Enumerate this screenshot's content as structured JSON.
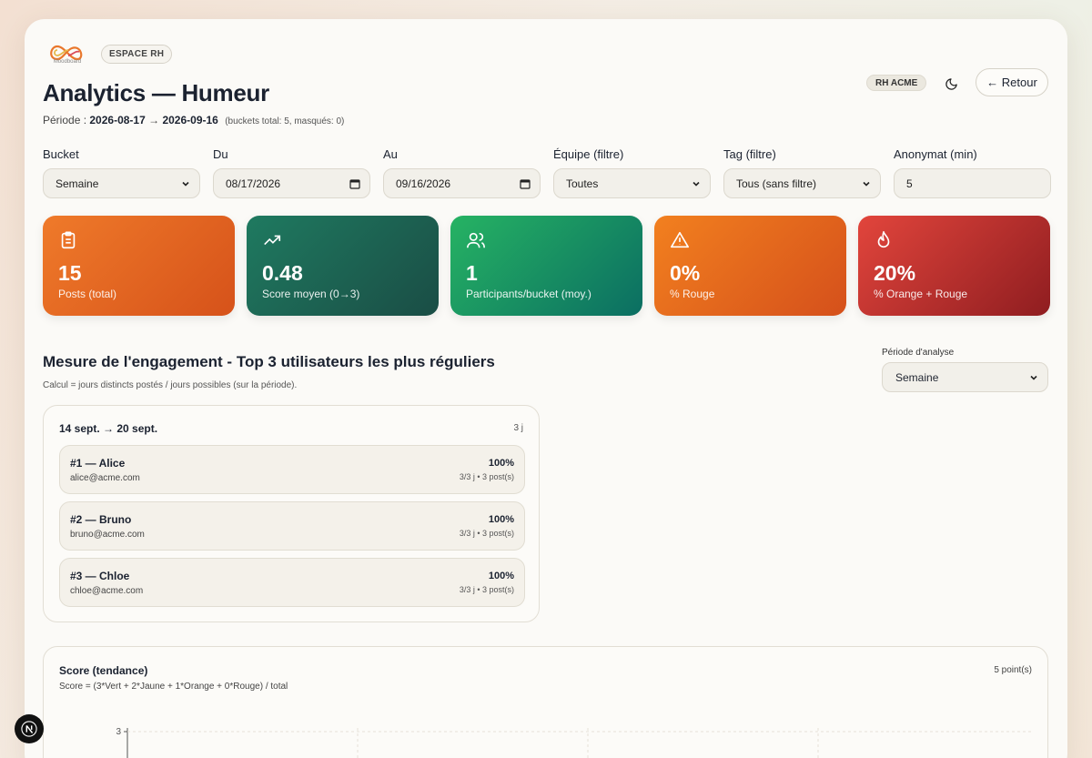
{
  "header": {
    "logo_text": "Moodboard",
    "space_badge": "ESPACE RH",
    "title": "Analytics — Humeur",
    "period_prefix": "Période :",
    "period_start": "2026-08-17",
    "period_arrow": "→",
    "period_end": "2026-09-16",
    "period_meta": "(buckets total: 5, masqués: 0)",
    "org_badge": "RH ACME",
    "back_label": "← Retour"
  },
  "filters": [
    {
      "label": "Bucket",
      "value": "Semaine",
      "kind": "select"
    },
    {
      "label": "Du",
      "value": "08/17/2026",
      "kind": "date"
    },
    {
      "label": "Au",
      "value": "09/16/2026",
      "kind": "date"
    },
    {
      "label": "Équipe (filtre)",
      "value": "Toutes",
      "kind": "select"
    },
    {
      "label": "Tag (filtre)",
      "value": "Tous (sans filtre)",
      "kind": "select"
    },
    {
      "label": "Anonymat (min)",
      "value": "5",
      "kind": "number"
    }
  ],
  "kpis": [
    {
      "value": "15",
      "label": "Posts (total)",
      "icon": "clipboard-icon"
    },
    {
      "value": "0.48",
      "label": "Score moyen (0→3)",
      "icon": "trending-up-icon"
    },
    {
      "value": "1",
      "label": "Participants/bucket (moy.)",
      "icon": "users-icon"
    },
    {
      "value": "0%",
      "label": "% Rouge",
      "icon": "warning-icon"
    },
    {
      "value": "20%",
      "label": "% Orange + Rouge",
      "icon": "flame-icon"
    }
  ],
  "engagement": {
    "title": "Mesure de l'engagement - Top 3 utilisateurs les plus réguliers",
    "subtitle": "Calcul = jours distincts postés / jours possibles (sur la période).",
    "period_label": "Période d'analyse",
    "period_value": "Semaine",
    "card": {
      "heading": "14 sept. → 20 sept.",
      "days": "3 j",
      "rows": [
        {
          "name": "#1 — Alice",
          "email": "alice@acme.com",
          "pct": "100%",
          "count": "3/3 j • 3 post(s)"
        },
        {
          "name": "#2 — Bruno",
          "email": "bruno@acme.com",
          "pct": "100%",
          "count": "3/3 j • 3 post(s)"
        },
        {
          "name": "#3 — Chloe",
          "email": "chloe@acme.com",
          "pct": "100%",
          "count": "3/3 j • 3 post(s)"
        }
      ]
    }
  },
  "score_chart": {
    "title": "Score (tendance)",
    "subtitle": "Score = (3*Vert + 2*Jaune + 1*Orange + 0*Rouge) / total",
    "points_label": "5 point(s)"
  },
  "chart_data": {
    "type": "line",
    "title": "Score (tendance)",
    "ylim": [
      0,
      3
    ],
    "yticks": [
      "3",
      "2.25"
    ],
    "grid": true,
    "series": []
  }
}
